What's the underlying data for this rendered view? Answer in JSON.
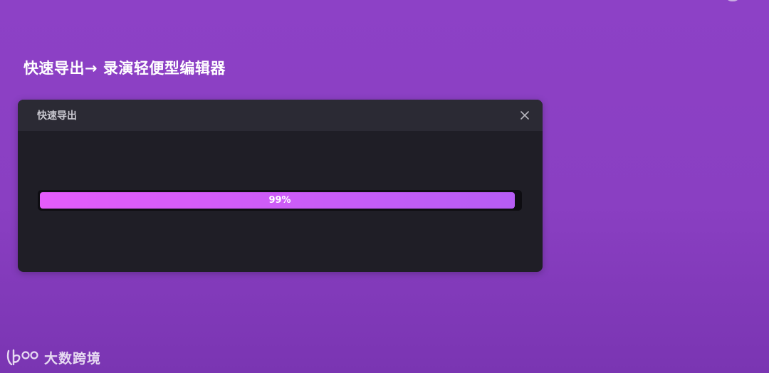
{
  "page": {
    "heading": "快速导出→ 录演轻便型编辑器"
  },
  "dialog": {
    "title": "快速导出",
    "close_icon": "close-icon"
  },
  "progress": {
    "value": 99,
    "label": "99%",
    "colors": {
      "start": "#e45cfa",
      "end": "#b65cf4",
      "track": "#0e0d12"
    }
  },
  "watermark": {
    "text": "大数跨境"
  },
  "colors": {
    "background": "#8d41c6",
    "dialog_body": "#1f1e26",
    "dialog_header": "#2b2a34"
  }
}
